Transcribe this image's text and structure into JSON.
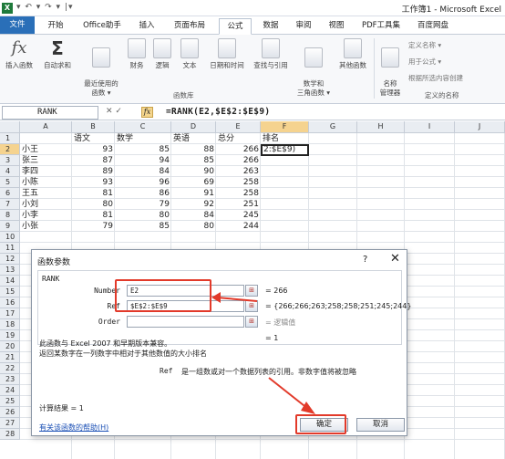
{
  "window": {
    "title": "工作簿1 - Microsoft Excel",
    "quick_access": "▾ ↶ ▾ ↷ ▾ |▾"
  },
  "tabs": [
    "文件",
    "开始",
    "Office助手",
    "插入",
    "页面布局",
    "公式",
    "数据",
    "审阅",
    "视图",
    "PDF工具集",
    "百度网盘"
  ],
  "active_tab": "公式",
  "ribbon": {
    "buttons": [
      {
        "label": "插入函数",
        "icon": "function-fx-icon"
      },
      {
        "label": "自动求和",
        "icon": "sigma-icon"
      },
      {
        "label": "最近使用的\n函数 ▾",
        "icon": "recent-functions-icon"
      },
      {
        "label": "财务",
        "icon": "finance-icon"
      },
      {
        "label": "逻辑",
        "icon": "logic-icon"
      },
      {
        "label": "文本",
        "icon": "text-icon"
      },
      {
        "label": "日期和时间",
        "icon": "date-time-icon"
      },
      {
        "label": "查找与引用",
        "icon": "lookup-icon"
      },
      {
        "label": "数学和\n三角函数 ▾",
        "icon": "math-icon"
      },
      {
        "label": "其他函数",
        "icon": "more-functions-icon"
      },
      {
        "label": "名称\n管理器",
        "icon": "name-manager-icon"
      }
    ],
    "group_function_library": "函数库",
    "group_defined_names": "定义的名称",
    "small_buttons": [
      "定义名称 ▾",
      "用于公式 ▾",
      "根据所选内容创建"
    ]
  },
  "formula_bar": {
    "name_box": "RANK",
    "cancel": "✕",
    "enter": "✓",
    "fx": "fx",
    "formula": "=RANK(E2,$E$2:$E$9)"
  },
  "sheet": {
    "columns": [
      "A",
      "B",
      "C",
      "D",
      "E",
      "F",
      "G",
      "H",
      "I",
      "J"
    ],
    "rows": [
      "1",
      "2",
      "3",
      "4",
      "5",
      "6",
      "7",
      "8",
      "9",
      "10",
      "11",
      "12",
      "13",
      "14",
      "15",
      "16",
      "17",
      "18",
      "19",
      "20",
      "21",
      "22",
      "23",
      "24",
      "25",
      "26",
      "27",
      "28"
    ],
    "headers": [
      "",
      "语文",
      "数学",
      "英语",
      "总分",
      "排名"
    ],
    "data": [
      [
        "小王",
        "93",
        "85",
        "88",
        "266"
      ],
      [
        "张三",
        "87",
        "94",
        "85",
        "266"
      ],
      [
        "李四",
        "89",
        "84",
        "90",
        "263"
      ],
      [
        "小陈",
        "93",
        "96",
        "69",
        "258"
      ],
      [
        "王五",
        "81",
        "86",
        "91",
        "258"
      ],
      [
        "小刘",
        "80",
        "79",
        "92",
        "251"
      ],
      [
        "小李",
        "81",
        "80",
        "84",
        "245"
      ],
      [
        "小张",
        "79",
        "85",
        "80",
        "244"
      ]
    ],
    "editing_cell": "2:$E$9)"
  },
  "dialog": {
    "title": "函数参数",
    "help_icon": "?",
    "close_icon": "✕",
    "function_name": "RANK",
    "args": [
      {
        "label": "Number",
        "value": "E2",
        "result": "= 266",
        "placeholder": false
      },
      {
        "label": "Ref",
        "value": "$E$2:$E$9",
        "result": "= {266;266;263;258;258;251;245;244}",
        "placeholder": false
      },
      {
        "label": "Order",
        "value": "",
        "result": "= 逻辑值",
        "placeholder": true
      }
    ],
    "overall_result": "= 1",
    "description_1": "此函数与 Excel 2007 和早期版本兼容。",
    "description_2": "返回某数字在一列数字中相对于其他数值的大小排名",
    "ref_help_label": "Ref",
    "ref_help_text": "是一组数或对一个数据列表的引用。非数字值将被忽略",
    "calc_result": "计算结果 = 1",
    "help_link": "有关该函数的帮助(H)",
    "ok_label": "确定",
    "cancel_label": "取消"
  },
  "annotation_color": "#e23a2a"
}
